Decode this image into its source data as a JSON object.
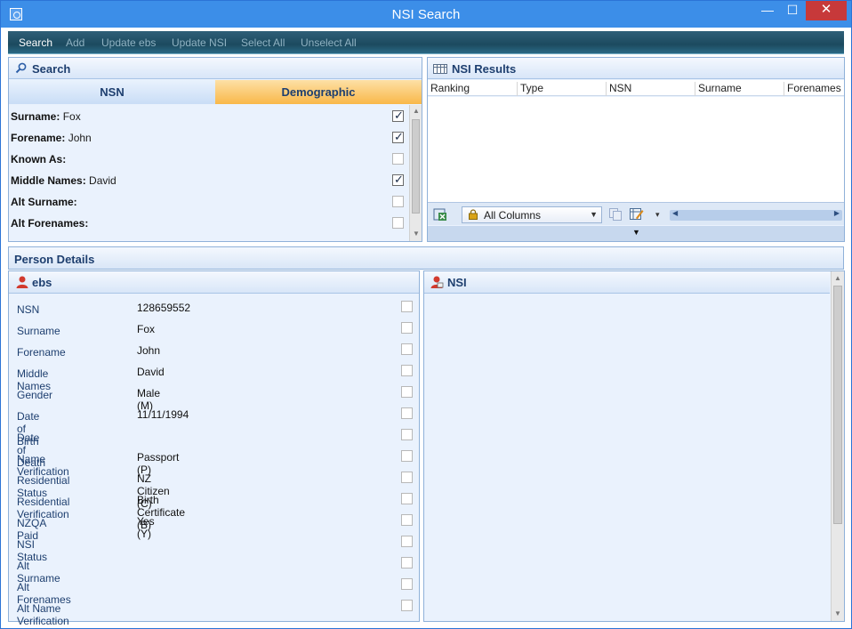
{
  "window": {
    "title": "NSI Search",
    "minimize": "—",
    "maximize": "☐",
    "close": "✕"
  },
  "toolbar": {
    "search": "Search",
    "add": "Add",
    "update_ebs": "Update ebs",
    "update_nsi": "Update NSI",
    "select_all": "Select All",
    "unselect_all": "Unselect All"
  },
  "search_panel": {
    "title": "Search",
    "tabs": {
      "nsn": "NSN",
      "demographic": "Demographic"
    },
    "fields": [
      {
        "label": "Surname:",
        "value": "Fox",
        "checked": true
      },
      {
        "label": "Forename:",
        "value": "John",
        "checked": true
      },
      {
        "label": "Known As:",
        "value": "",
        "checked": false
      },
      {
        "label": "Middle Names:",
        "value": "David",
        "checked": true
      },
      {
        "label": "Alt Surname:",
        "value": "",
        "checked": false
      },
      {
        "label": "Alt Forenames:",
        "value": "",
        "checked": false
      }
    ]
  },
  "results_panel": {
    "title": "NSI Results",
    "columns": [
      "Ranking",
      "Type",
      "NSN",
      "Surname",
      "Forenames"
    ],
    "column_filter": "All Columns"
  },
  "person_details": {
    "title": "Person Details",
    "ebs_title": "ebs",
    "nsi_title": "NSI",
    "fields": [
      {
        "label": "NSN",
        "value": "128659552"
      },
      {
        "label": "Surname",
        "value": "Fox"
      },
      {
        "label": "Forename",
        "value": "John"
      },
      {
        "label": "Middle Names",
        "value": "David"
      },
      {
        "label": "Gender",
        "value": "Male (M)"
      },
      {
        "label": "Date of Birth",
        "value": "11/11/1994"
      },
      {
        "label": "Date of Death",
        "value": ""
      },
      {
        "label": "Name Verification",
        "value": "Passport (P)"
      },
      {
        "label": "Residential Status",
        "value": "NZ Citizen (C)"
      },
      {
        "label": "Residential Verification",
        "value": "Birth Certificate (B)"
      },
      {
        "label": "NZQA Paid",
        "value": "Yes (Y)"
      },
      {
        "label": "NSI Status",
        "value": ""
      },
      {
        "label": "Alt Surname",
        "value": ""
      },
      {
        "label": "Alt Forenames",
        "value": ""
      },
      {
        "label": "Alt Name Verification",
        "value": ""
      }
    ]
  },
  "colors": {
    "titlebar": "#3c8ee8",
    "close": "#c7393a",
    "demographic_tab": "#f9b849",
    "panel_bg": "#eaf2fd",
    "label_text": "#1e3f6f"
  }
}
